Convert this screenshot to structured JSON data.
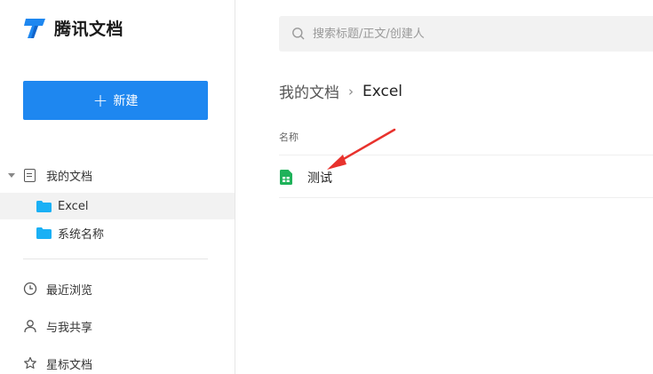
{
  "app": {
    "name": "腾讯文档"
  },
  "sidebar": {
    "new_button": {
      "icon": "plus-icon",
      "label": "新建"
    },
    "tree": {
      "root": {
        "label": "我的文档",
        "icon": "document-icon"
      },
      "folders": [
        {
          "label": "Excel",
          "icon": "folder-icon",
          "selected": true
        },
        {
          "label": "系统名称",
          "icon": "folder-icon",
          "selected": false
        }
      ]
    },
    "nav": [
      {
        "label": "最近浏览",
        "icon": "clock-icon"
      },
      {
        "label": "与我共享",
        "icon": "person-icon"
      },
      {
        "label": "星标文档",
        "icon": "star-icon"
      }
    ]
  },
  "search": {
    "placeholder": "搜索标题/正文/创建人"
  },
  "breadcrumb": {
    "root": "我的文档",
    "current": "Excel"
  },
  "list": {
    "column_name": "名称",
    "files": [
      {
        "name": "测试",
        "icon": "sheet-icon"
      }
    ]
  },
  "colors": {
    "primary": "#1e87f0",
    "folder": "#1ab0f5",
    "sheet": "#1fb25a",
    "annotation_arrow": "#e8322d"
  }
}
